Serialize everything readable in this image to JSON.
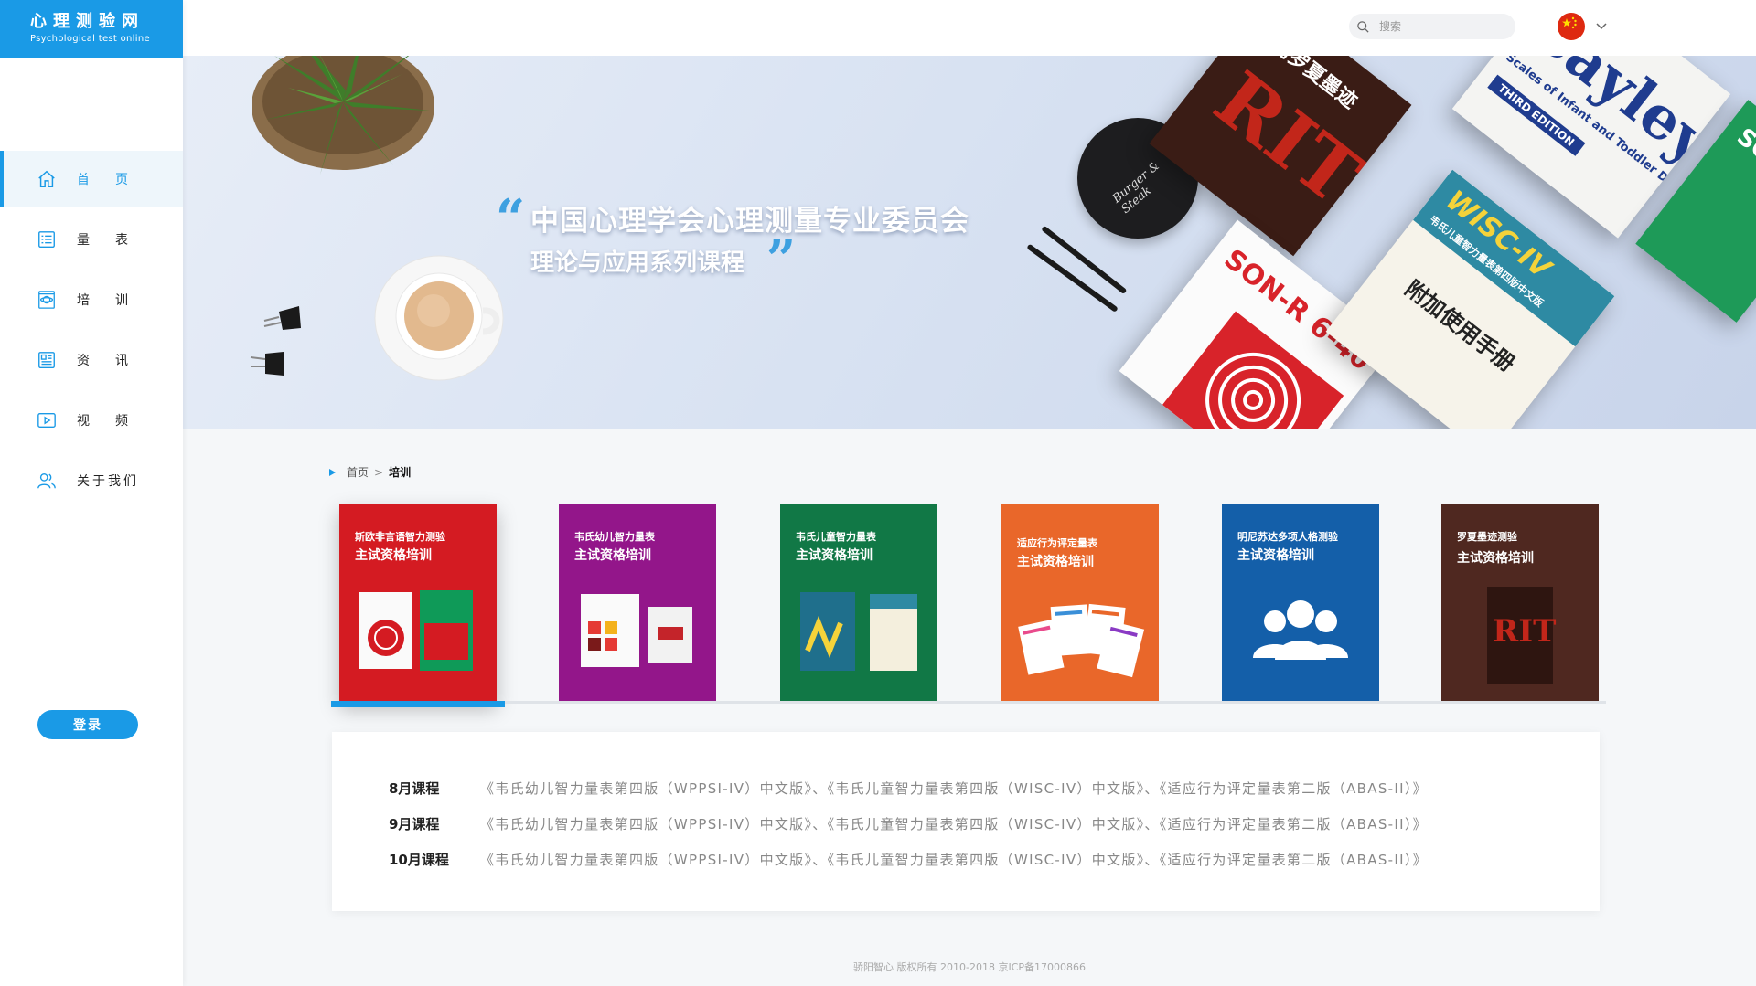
{
  "brand": {
    "name_cn": "心理测验网",
    "name_en": "Psychological test online",
    "color": "#1a9ae6"
  },
  "nav": {
    "items": [
      {
        "label": "首页",
        "icon": "home-icon",
        "active": true
      },
      {
        "label": "量表",
        "icon": "list-icon",
        "active": false
      },
      {
        "label": "培训",
        "icon": "training-icon",
        "active": false
      },
      {
        "label": "资讯",
        "icon": "news-icon",
        "active": false
      },
      {
        "label": "视频",
        "icon": "video-icon",
        "active": false
      },
      {
        "label": "关于我们",
        "icon": "users-icon",
        "active": false
      }
    ],
    "login_label": "登录"
  },
  "header": {
    "search_placeholder": "搜索",
    "language_icon": "china-flag-icon"
  },
  "banner": {
    "line1": "中国心理学会心理测量专业委员会",
    "line2": "理论与应用系列课程",
    "quote_open": "“",
    "quote_close": "”",
    "coaster_text": "Burger & Steak",
    "books": [
      "实用罗夏墨迹",
      "RIT",
      "Bayley",
      "Scales of Infant and Toddler Development",
      "THIRD EDITION",
      "SON-R",
      "SON-R 6-40",
      "WISC-IV",
      "韦氏儿童智力量表第四版中文版",
      "附加使用手册"
    ]
  },
  "breadcrumb": {
    "home": "首页",
    "separator": ">",
    "current": "培训"
  },
  "cards": [
    {
      "title": "斯欧非言语智力测验",
      "subtitle": "主试资格培训",
      "color": "#d41b22"
    },
    {
      "title": "韦氏幼儿智力量表",
      "subtitle": "主试资格培训",
      "color": "#93168a"
    },
    {
      "title": "韦氏儿童智力量表",
      "subtitle": "主试资格培训",
      "color": "#117846"
    },
    {
      "title": "适应行为评定量表",
      "subtitle": "主试资格培训",
      "color": "#e9672a"
    },
    {
      "title": "明尼苏达多项人格测验",
      "subtitle": "主试资格培训",
      "color": "#145fa9"
    },
    {
      "title": "罗夏墨迹测验",
      "subtitle": "主试资格培训",
      "color": "#4f2820"
    }
  ],
  "courses": [
    {
      "month": "8月课程",
      "text": "《韦氏幼儿智力量表第四版（WPPSI-IV）中文版》、《韦氏儿童智力量表第四版（WISC-IV）中文版》、《适应行为评定量表第二版（ABAS-II）》"
    },
    {
      "month": "9月课程",
      "text": "《韦氏幼儿智力量表第四版（WPPSI-IV）中文版》、《韦氏儿童智力量表第四版（WISC-IV）中文版》、《适应行为评定量表第二版（ABAS-II）》"
    },
    {
      "month": "10月课程",
      "text": "《韦氏幼儿智力量表第四版（WPPSI-IV）中文版》、《韦氏儿童智力量表第四版（WISC-IV）中文版》、《适应行为评定量表第二版（ABAS-II）》"
    }
  ],
  "footer": {
    "text": "骄阳智心 版权所有 2010-2018 京ICP备17000866"
  }
}
